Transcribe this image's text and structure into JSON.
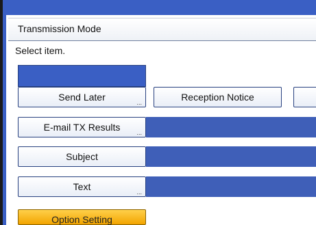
{
  "header": {
    "title": "Transmission Mode"
  },
  "prompt": "Select item.",
  "buttons": {
    "send_later": "Send Later",
    "reception_notice": "Reception Notice",
    "email_tx_results": "E-mail TX Results",
    "subject": "Subject",
    "text": "Text",
    "option_setting": "Option Setting"
  },
  "ellipsis": "...",
  "colors": {
    "accent_blue": "#3a5fc4",
    "field_blue": "#3f5fb8",
    "option_orange": "#f2a400"
  }
}
